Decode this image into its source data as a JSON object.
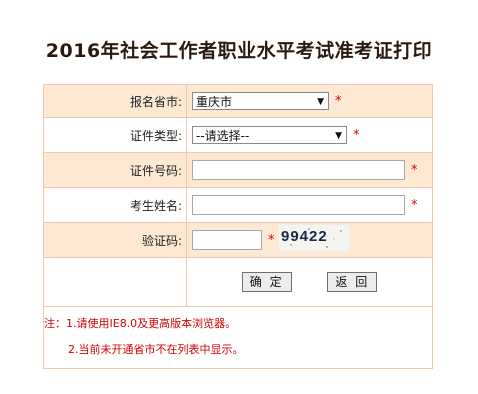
{
  "page": {
    "title": "2016年社会工作者职业水平考试准考证打印"
  },
  "form": {
    "province": {
      "label": "报名省市:",
      "value": "重庆市",
      "required_mark": "*"
    },
    "id_type": {
      "label": "证件类型:",
      "value": "--请选择--",
      "required_mark": "*"
    },
    "id_number": {
      "label": "证件号码:",
      "value": "",
      "required_mark": "*"
    },
    "name": {
      "label": "考生姓名:",
      "value": "",
      "required_mark": "*"
    },
    "captcha": {
      "label": "验证码:",
      "value": "",
      "required_mark": "*",
      "image_text": "99422"
    },
    "buttons": {
      "confirm": "确 定",
      "back": "返 回"
    }
  },
  "notes": {
    "line1": "注：1.请使用IE8.0及更高版本浏览器。",
    "line2": "2.当前未开通省市不在列表中显示。"
  },
  "colors": {
    "label_row_bg": "#fde8d4",
    "border": "#f2c7a8",
    "required": "#e00000",
    "note_text": "#d40000"
  }
}
